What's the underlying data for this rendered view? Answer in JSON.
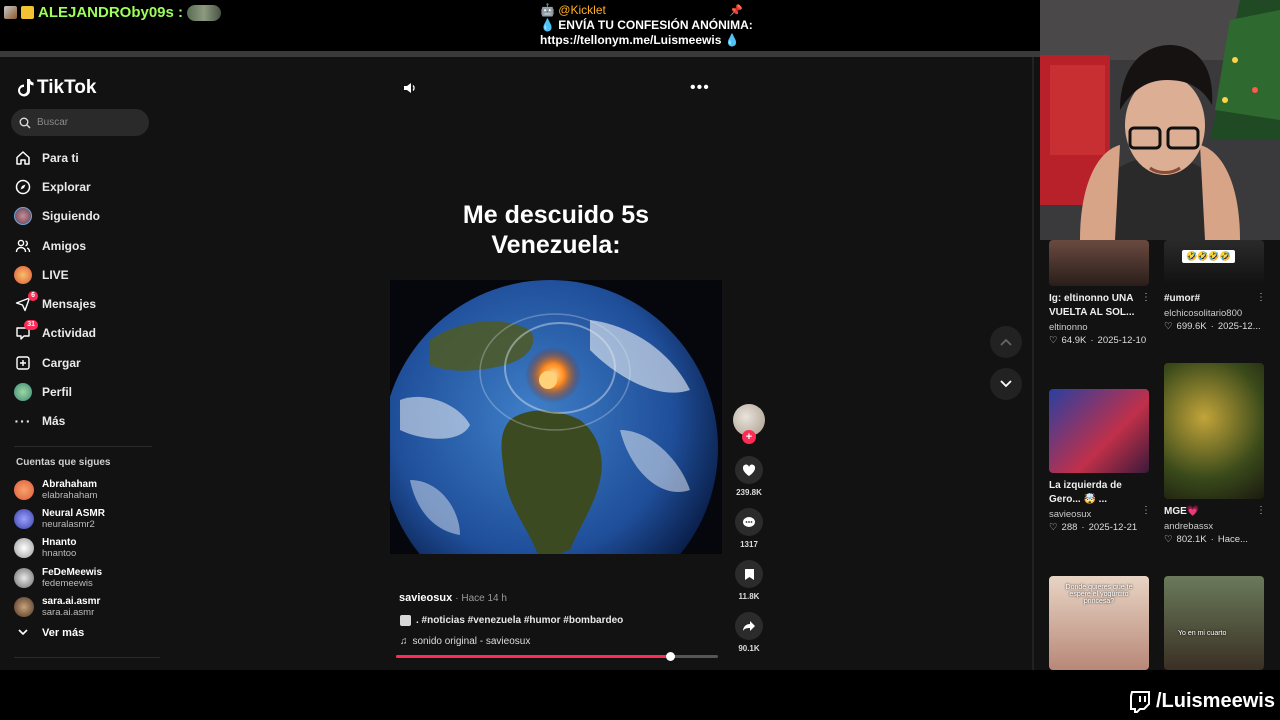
{
  "stream_overlay": {
    "chat_user": "ALEJANDROby09s :",
    "pinned_author": "@Kicklet",
    "pinned_line1": "ENVÍA TU CONFESIÓN ANÓNIMA:",
    "pinned_line2": "https://tellonym.me/Luismeewis",
    "twitch_handle": "/Luismeewis"
  },
  "tiktok": {
    "logo": "TikTok",
    "search_placeholder": "Buscar",
    "nav": [
      {
        "label": "Para ti",
        "icon": "home-icon"
      },
      {
        "label": "Explorar",
        "icon": "compass-icon"
      },
      {
        "label": "Siguiendo",
        "icon": "following-avatar-icon"
      },
      {
        "label": "Amigos",
        "icon": "friends-icon"
      },
      {
        "label": "LIVE",
        "icon": "live-icon"
      },
      {
        "label": "Mensajes",
        "icon": "send-icon",
        "badge": "6"
      },
      {
        "label": "Actividad",
        "icon": "inbox-icon",
        "badge": "31"
      },
      {
        "label": "Cargar",
        "icon": "upload-icon"
      },
      {
        "label": "Perfil",
        "icon": "profile-avatar-icon"
      },
      {
        "label": "Más",
        "icon": "more-dots-icon"
      }
    ],
    "following_title": "Cuentas que sigues",
    "following": [
      {
        "name": "Abrahaham",
        "handle": "elabrahaham",
        "color": "#e05a3a"
      },
      {
        "name": "Neural ASMR",
        "handle": "neuralasmr2",
        "color": "#5b5fd6"
      },
      {
        "name": "Hnanto",
        "handle": "hnantoo",
        "color": "#dcdcdc"
      },
      {
        "name": "FeDeMeewis",
        "handle": "fedemeewis",
        "color": "#b9b9b9"
      },
      {
        "name": "sara.ai.asmr",
        "handle": "sara.ai.asmr",
        "color": "#8a6a50"
      }
    ],
    "see_more": "Ver más"
  },
  "video": {
    "caption_line1": "Me descuido 5s",
    "caption_line2": "Venezuela:",
    "author": "savieosux",
    "time": "· Hace 14 h",
    "tags": ". #noticias #venezuela #humor #bombardeo",
    "sound": "sonido original - savieosux",
    "progress": 0.85,
    "likes": "239.8K",
    "comments": "1317",
    "saves": "11.8K",
    "shares": "90.1K"
  },
  "recommendations": [
    {
      "title": "Ig: eltinonno UNA VUELTA AL SOL...",
      "author": "eltinonno",
      "likes": "64.9K",
      "date": "2025-12-10"
    },
    {
      "title": "#umor#",
      "author": "elchicosolitario800",
      "likes": "699.6K",
      "date": "2025-12..."
    },
    {
      "title": "La izquierda de Gero... 🤯 ...",
      "author": "savieosux",
      "likes": "288",
      "date": "2025-12-21"
    },
    {
      "title": "MGE💗",
      "author": "andrebassx",
      "likes": "802.1K",
      "date": "Hace..."
    }
  ],
  "thumb_texts": {
    "umor_emojis": "🤣🤣🤣🤣",
    "card5_text": "Donde quieres que te espere el yogurcito princesa?",
    "card6_text": "Yo en mi cuarto"
  }
}
